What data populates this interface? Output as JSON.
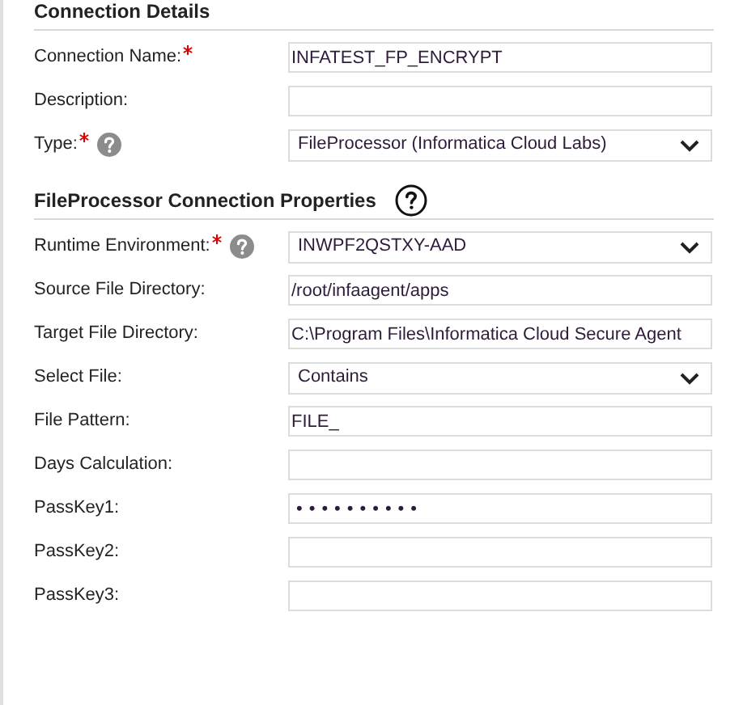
{
  "sections": [
    {
      "title": "Connection Details",
      "help": false,
      "fields": [
        {
          "label": "Connection Name:",
          "required": true,
          "help": false,
          "kind": "text",
          "value": "INFATEST_FP_ENCRYPT"
        },
        {
          "label": "Description:",
          "required": false,
          "help": false,
          "kind": "text"
        },
        {
          "label": "Type:",
          "required": true,
          "help": true,
          "kind": "select",
          "value": "FileProcessor (Informatica Cloud Labs)"
        }
      ]
    },
    {
      "title": "FileProcessor Connection Properties",
      "help": true,
      "fields": [
        {
          "label": "Runtime Environment:",
          "required": true,
          "help": true,
          "kind": "select",
          "value": "INWPF2QSTXY-AAD"
        },
        {
          "label": "Source File Directory:",
          "required": false,
          "help": false,
          "kind": "text",
          "value": "/root/infaagent/apps"
        },
        {
          "label": "Target File Directory:",
          "required": false,
          "help": false,
          "kind": "text",
          "value": "C:\\Program Files\\Informatica Cloud Secure Agent"
        },
        {
          "label": "Select File:",
          "required": false,
          "help": false,
          "kind": "select",
          "value": "Contains"
        },
        {
          "label": "File Pattern:",
          "required": false,
          "help": false,
          "kind": "text",
          "value": "FILE_"
        },
        {
          "label": "Days Calculation:",
          "required": false,
          "help": false,
          "kind": "text"
        },
        {
          "label": "PassKey1:",
          "required": false,
          "help": false,
          "kind": "password",
          "value": "••••••••••"
        },
        {
          "label": "PassKey2:",
          "required": false,
          "help": false,
          "kind": "password"
        },
        {
          "label": "PassKey3:",
          "required": false,
          "help": false,
          "kind": "password"
        }
      ]
    }
  ]
}
